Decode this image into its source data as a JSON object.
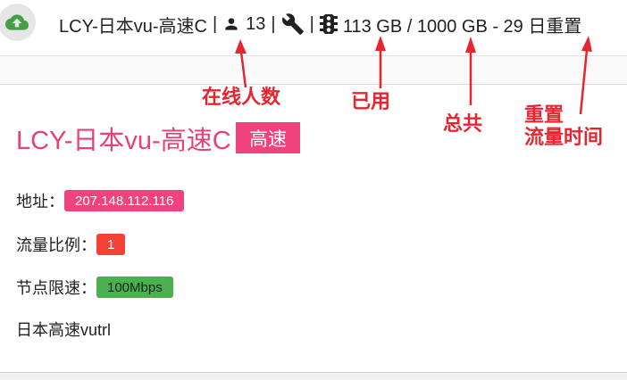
{
  "topbar": {
    "upload_icon": "cloud-upload-icon",
    "node_name": "LCY-日本vu-高速C",
    "sep1": "|",
    "user_icon": "person-icon",
    "online_count": "13",
    "sep2": "|",
    "wrench_icon": "wrench-icon",
    "sep3": "|",
    "traffic_icon": "traffic-light-icon",
    "traffic_text": "113 GB / 1000 GB - 29 日重置"
  },
  "annotations": {
    "online": "在线人数",
    "used": "已用",
    "total": "总共",
    "reset_line1": "重置",
    "reset_line2": "流量时间"
  },
  "card": {
    "title": "LCY-日本vu-高速C",
    "badge": "高速",
    "address_label": "地址：",
    "address_value": "207.148.112.116",
    "ratio_label": "流量比例：",
    "ratio_value": "1",
    "speed_label": "节点限速：",
    "speed_value": "100Mbps",
    "description": "日本高速vutrl"
  },
  "colors": {
    "accent_pink": "#f0437d",
    "title_pink": "#e5417a",
    "badge_red": "#f44336",
    "badge_green": "#4caf50",
    "annotation_red": "#e8252f",
    "upload_green": "#43a047"
  }
}
